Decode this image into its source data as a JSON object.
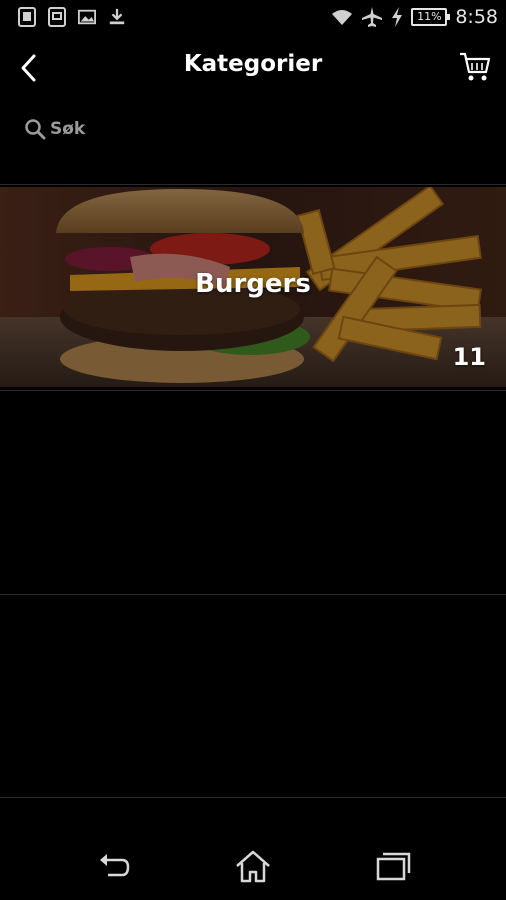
{
  "status_bar": {
    "time": "8:58",
    "battery": "11%",
    "icons": [
      "notification-icon",
      "sim-icon",
      "image-icon",
      "download-icon",
      "wifi-icon",
      "airplane-icon",
      "charging-icon",
      "battery-icon"
    ]
  },
  "header": {
    "title": "Kategorier",
    "back_icon": "chevron-left-icon",
    "cart_icon": "cart-icon"
  },
  "search": {
    "label": "Søk",
    "icon": "search-icon"
  },
  "categories": [
    {
      "name": "Burgers",
      "count": "11"
    }
  ],
  "nav": {
    "icons": [
      "back-icon",
      "home-icon",
      "recent-apps-icon"
    ]
  }
}
